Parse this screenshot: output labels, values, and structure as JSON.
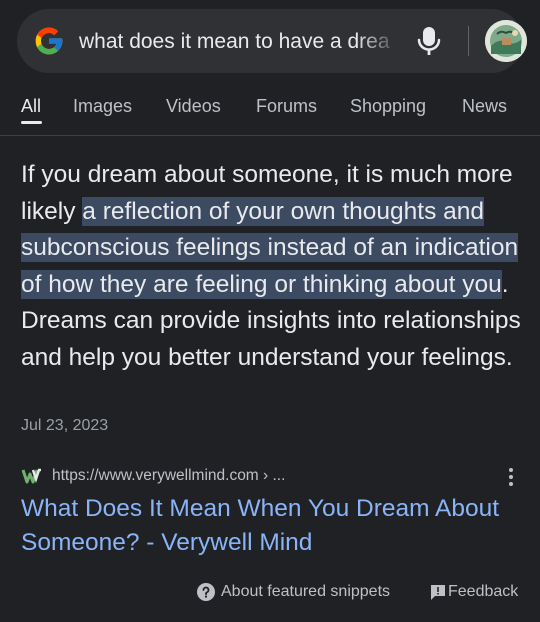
{
  "search": {
    "query": "what does it mean to have a drea",
    "logo_icon": "google-g-icon",
    "mic_icon": "microphone-icon",
    "colors": {
      "background": "#202124",
      "bar": "#303134"
    }
  },
  "tabs": [
    {
      "label": "All",
      "active": true
    },
    {
      "label": "Images"
    },
    {
      "label": "Videos"
    },
    {
      "label": "Forums"
    },
    {
      "label": "Shopping"
    },
    {
      "label": "News"
    }
  ],
  "snippet": {
    "text_before": "If you dream about someone, it is much more likely ",
    "text_highlight": "a reflection of your own thoughts and subconscious feelings instead of an indication of how they are feeling or thinking about you",
    "text_after": ". Dreams can provide insights into relationships and help you better understand your feelings.",
    "date": "Jul 23, 2023",
    "highlight_color": "#3c4a62"
  },
  "source": {
    "url": "https://www.verywellmind.com › ...",
    "favicon": "verywell-w-icon",
    "title": "What Does It Mean When You Dream About Someone? - Verywell Mind",
    "title_color": "#8ab4f8"
  },
  "footer": {
    "about_label": "About featured snippets",
    "feedback_label": "Feedback"
  }
}
